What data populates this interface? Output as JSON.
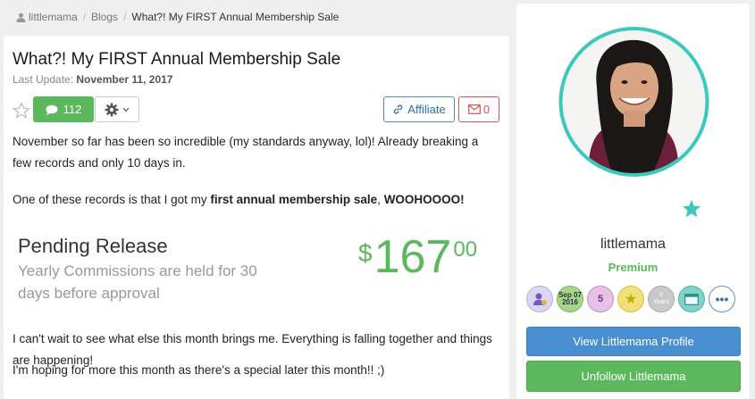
{
  "breadcrumb": {
    "user": "littlemama",
    "section": "Blogs",
    "current": "What?! My FIRST Annual Membership Sale"
  },
  "post": {
    "title": "What?! My FIRST Annual Membership Sale",
    "last_update_label": "Last Update:",
    "last_update_date": "November 11, 2017",
    "comment_count": "112",
    "affiliate_label": "Affiliate",
    "mail_count": "0",
    "para1": "November so far has been so incredible (my standards anyway, lol)! Already breaking a few records and only 10 days in.",
    "para2_prefix": "One of these records is that I got my ",
    "para2_bold": "first annual membership sale",
    "para2_mid": ", ",
    "para2_bold2": "WOOHOOOO!",
    "pending_title": "Pending Release",
    "pending_sub": "Yearly Commissions are held for 30 days before approval",
    "price_currency": "$",
    "price_whole": "167",
    "price_cents": "00",
    "para3": "I can't wait to see what else this month brings me. Everything is falling together and things are happening!",
    "para4": "I'm hoping for more this month as there's a special later this month!! ;)"
  },
  "profile": {
    "username": "littlemama",
    "level": "Premium",
    "badges": [
      {
        "icon": "user-badge-icon"
      },
      {
        "line1": "Sep 07",
        "line2": "2016"
      },
      {
        "text": "5"
      },
      {
        "text": "★"
      },
      {
        "line1": "2",
        "line2": "Years"
      },
      {
        "icon": "window-badge-icon"
      },
      {
        "text": "•••"
      }
    ],
    "view_profile_label": "View Littlemama Profile",
    "unfollow_label": "Unfollow Littlemama"
  },
  "colors": {
    "accent_green": "#5cb85c",
    "accent_blue": "#4a8ed2",
    "avatar_ring": "#3cc9bd",
    "danger": "#d9534f"
  }
}
